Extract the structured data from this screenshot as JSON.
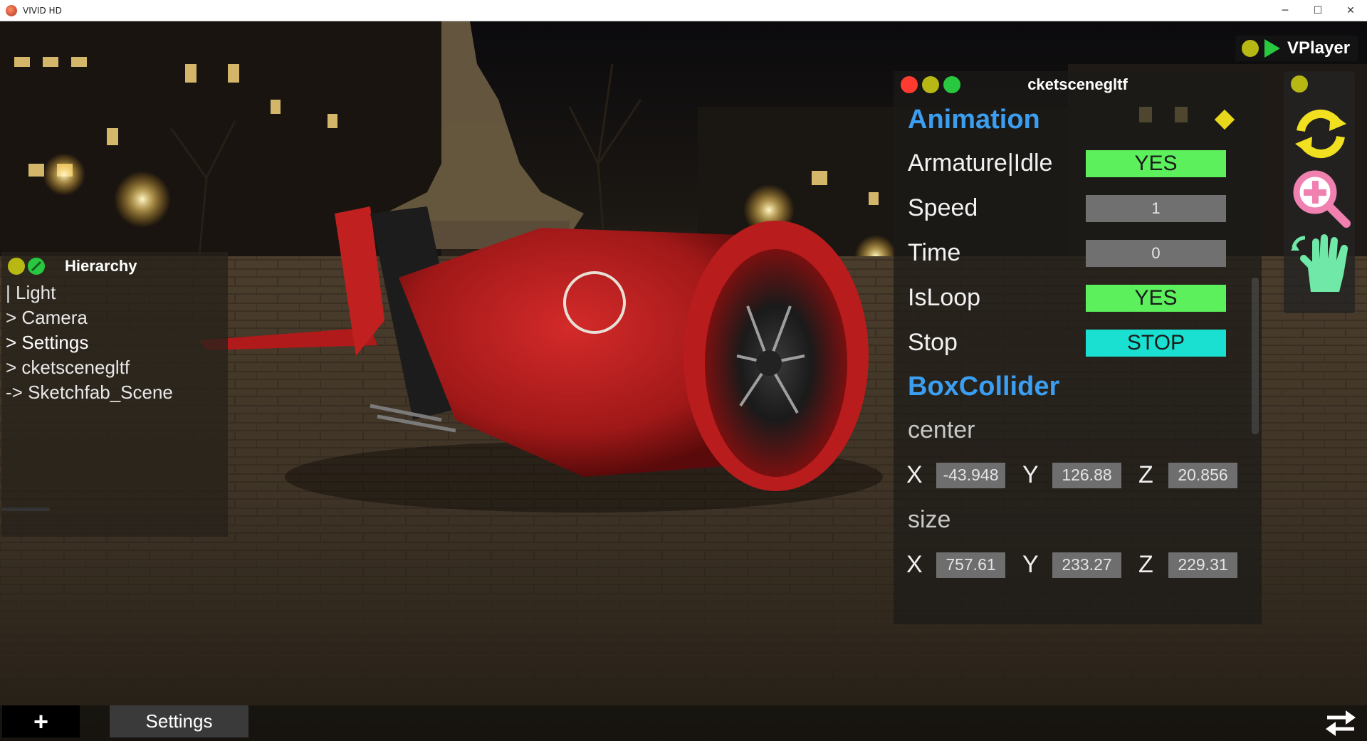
{
  "window": {
    "title": "VIVID HD",
    "controls": {
      "minimize": "─",
      "maximize": "☐",
      "close": "✕"
    }
  },
  "vplayer": {
    "label": "VPlayer"
  },
  "hierarchy": {
    "title": "Hierarchy",
    "items": [
      {
        "label": "| Light"
      },
      {
        "label": "> Camera"
      },
      {
        "label": "> Settings",
        "selected": true
      },
      {
        "label": "> cketscenegltf"
      },
      {
        "label": "-> Sketchfab_Scene"
      }
    ]
  },
  "inspector": {
    "title": "cketscenegltf",
    "animation": {
      "section_title": "Animation",
      "props": [
        {
          "label": "Armature|Idle",
          "value": "YES",
          "kind": "yes"
        },
        {
          "label": "Speed",
          "value": "1",
          "kind": "num"
        },
        {
          "label": "Time",
          "value": "0",
          "kind": "num"
        },
        {
          "label": "IsLoop",
          "value": "YES",
          "kind": "yes"
        },
        {
          "label": "Stop",
          "value": "STOP",
          "kind": "stop"
        }
      ]
    },
    "box_collider": {
      "section_title": "BoxCollider",
      "center": {
        "label": "center",
        "x": "-43.948",
        "y": "126.88",
        "z": "20.856"
      },
      "size": {
        "label": "size",
        "x": "757.61",
        "y": "233.27",
        "z": "229.31"
      },
      "axis_x": "X",
      "axis_y": "Y",
      "axis_z": "Z"
    }
  },
  "tools": [
    {
      "name": "sync-rotate-icon",
      "color": "#f0e020"
    },
    {
      "name": "zoom-in-icon",
      "color": "#f080b0"
    },
    {
      "name": "pan-hand-icon",
      "color": "#70e8a8"
    }
  ],
  "bottom_bar": {
    "add_label": "+",
    "settings_label": "Settings"
  },
  "colors": {
    "accent_blue": "#3c9ef0",
    "yes_green": "#5cf05c",
    "stop_cyan": "#19e0d0",
    "traffic_red": "#ff3b30",
    "traffic_olive": "#b8b814",
    "traffic_green": "#28c840"
  }
}
